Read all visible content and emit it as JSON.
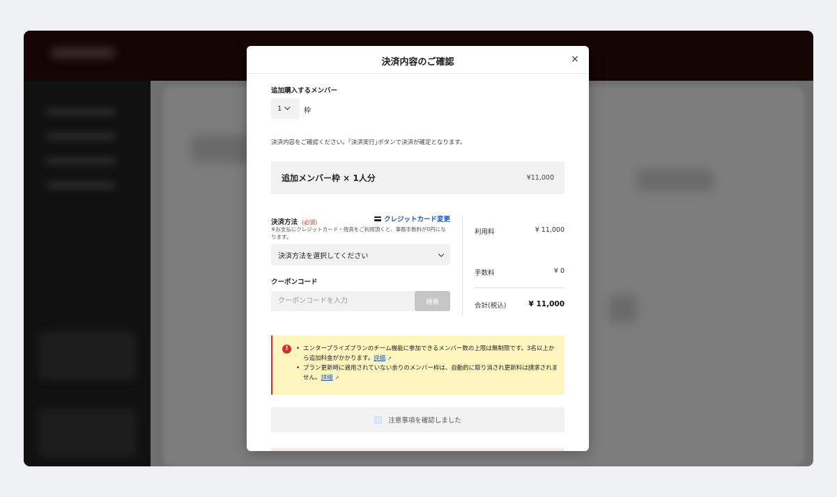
{
  "modal": {
    "title": "決済内容のご確認",
    "close_symbol": "×"
  },
  "members": {
    "label": "追加購入するメンバー",
    "quantity": "1",
    "unit": "枠"
  },
  "confirm_note": "決済内容をご確認ください。｢決済実行｣ボタンで決済が確定となります。",
  "line_item": {
    "name": "追加メンバー枠 × 1人分",
    "price": "¥11,000"
  },
  "payment": {
    "label": "決済方法",
    "required": "(必須)",
    "change_card_link": "クレジットカード変更",
    "note": "※お支払にクレジットカード・残高をご利用頂くと、事務手数料が0円になります。",
    "select_value": "決済方法を選択してください"
  },
  "coupon": {
    "label": "クーポンコード",
    "placeholder": "クーポンコードを入力",
    "search_button": "検索"
  },
  "summary": {
    "usage_fee_label": "利用料",
    "usage_fee_value": "¥ 11,000",
    "handling_fee_label": "手数料",
    "handling_fee_value": "¥ 0",
    "total_label": "合計(税込)",
    "total_value": "¥ 11,000"
  },
  "warning": {
    "item1_text": "エンタープライズプランのチーム機能に参加できるメンバー数の上限は無制限です。3名以上から追加料金がかかります。",
    "item1_link": "詳細",
    "item2_text": "プラン更新時に適用されていない余りのメンバー枠は、自動的に取り消され更新料は請求されません。",
    "item2_link": "詳細",
    "icon_glyph": "!"
  },
  "acknowledge": {
    "label": "注意事項を確認しました"
  },
  "colors": {
    "link": "#1a55c9",
    "required": "#d32f2f",
    "warning_bg": "#fff6bf",
    "warning_accent": "#d42a2a"
  }
}
